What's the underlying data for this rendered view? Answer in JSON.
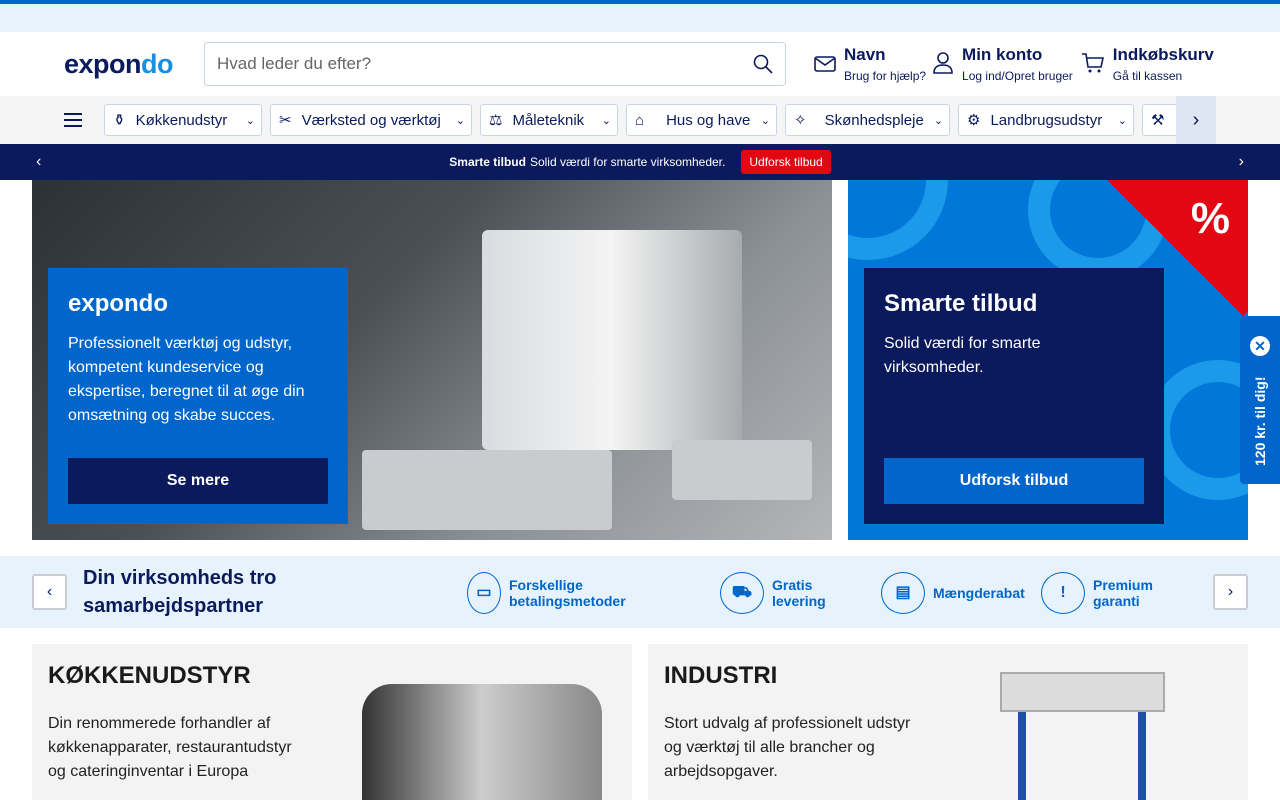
{
  "header": {
    "logo_a": "expon",
    "logo_b": "do",
    "search_placeholder": "Hvad leder du efter?",
    "contact": {
      "title": "Navn",
      "sub": "Brug for hjælp?"
    },
    "account": {
      "title": "Min konto",
      "sub": "Log ind/Opret bruger"
    },
    "cart": {
      "title": "Indkøbskurv",
      "sub": "Gå til kassen"
    }
  },
  "nav": {
    "categories": [
      {
        "label": "Køkkenudstyr",
        "icon": "⚱"
      },
      {
        "label": "Værksted og værktøj",
        "icon": "✂"
      },
      {
        "label": "Måleteknik",
        "icon": "⚖"
      },
      {
        "label": "Hus og have",
        "icon": "⌂"
      },
      {
        "label": "Skønhedspleje",
        "icon": "✧"
      },
      {
        "label": "Landbrugsudstyr",
        "icon": "⚙"
      }
    ]
  },
  "promo": {
    "bold": "Smarte tilbud",
    "text": "Solid værdi for smarte virksomheder.",
    "button": "Udforsk tilbud"
  },
  "hero": {
    "title": "expondo",
    "text": "Professionelt værktøj og udstyr, kompetent kundeservice og ekspertise, beregnet til at øge din omsætning og skabe succes.",
    "button": "Se mere"
  },
  "side": {
    "badge": "%",
    "title": "Smarte tilbud",
    "text": "Solid værdi for smarte virksomheder.",
    "button": "Udforsk tilbud"
  },
  "floating_tab": "120 kr. til dig!",
  "usp": {
    "title": "Din virksomheds tro samarbejdspartner",
    "items": [
      {
        "label": "Forskellige betalingsmetoder",
        "icon": "▭"
      },
      {
        "label": "Gratis levering",
        "icon": "⛟"
      },
      {
        "label": "Mængderabat",
        "icon": "▤"
      },
      {
        "label": "Premium garanti",
        "icon": "!"
      }
    ]
  },
  "cards": [
    {
      "title": "KØKKENUDSTYR",
      "text": "Din renommerede forhandler af køkkenapparater, restaurantudstyr og cateringinventar i Europa"
    },
    {
      "title": "INDUSTRI",
      "text": "Stort udvalg af professionelt udstyr og værktøj til alle brancher og arbejdsopgaver."
    }
  ]
}
